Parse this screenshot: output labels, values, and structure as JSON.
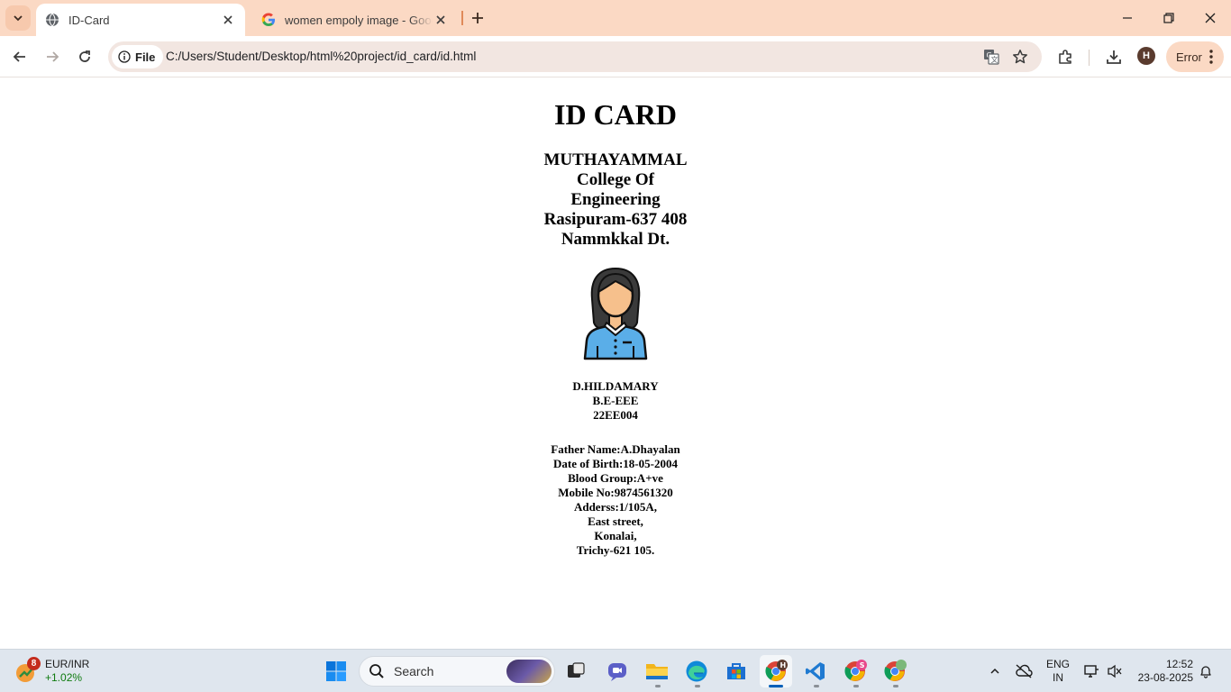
{
  "browser": {
    "tabs": [
      {
        "title": "ID-Card",
        "active": true
      },
      {
        "title": "women empoly image - Google Search",
        "active": false
      }
    ],
    "omnibox": {
      "chip_label": "File",
      "url": "C:/Users/Student/Desktop/html%20project/id_card/id.html"
    },
    "profile_initial": "H",
    "error_label": "Error"
  },
  "page": {
    "title": "ID CARD",
    "college_lines": [
      "MUTHAYAMMAL",
      "College Of",
      "Engineering",
      "Rasipuram-637 408",
      "Nammkkal Dt."
    ],
    "student": {
      "name": "D.HILDAMARY",
      "course": "B.E-EEE",
      "reg_no": "22EE004"
    },
    "details": [
      "Father Name:A.Dhayalan",
      "Date of Birth:18-05-2004",
      "Blood Group:A+ve",
      "Mobile No:9874561320",
      "Adderss:1/105A,",
      "East street,",
      "Konalai,",
      "Trichy-621 105."
    ]
  },
  "taskbar": {
    "widget": {
      "badge": "8",
      "pair": "EUR/INR",
      "change": "+1.02%"
    },
    "search_placeholder": "Search",
    "app_badges": {
      "chrome_profile": "H",
      "chrome_profile2": "S"
    },
    "language": {
      "line1": "ENG",
      "line2": "IN"
    },
    "clock": {
      "time": "12:52",
      "date": "23-08-2025"
    }
  }
}
